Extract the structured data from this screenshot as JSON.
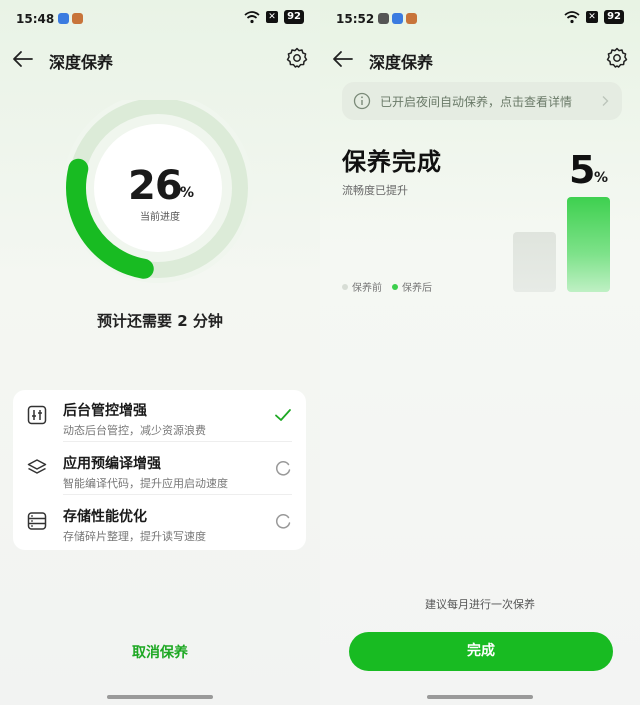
{
  "left": {
    "status": {
      "time": "15:48",
      "battery": "92",
      "x_badge": "✕"
    },
    "header": {
      "title": "深度保养"
    },
    "progress": {
      "value": "26",
      "unit": "%",
      "fraction": 0.26,
      "label": "当前进度"
    },
    "eta": "预计还需要 2 分钟",
    "tasks": [
      {
        "name": "后台管控增强",
        "desc": "动态后台管控，减少资源浪费",
        "state": "done",
        "icon": "sliders-icon"
      },
      {
        "name": "应用预编译增强",
        "desc": "智能编译代码，提升应用启动速度",
        "state": "loading",
        "icon": "layers-icon"
      },
      {
        "name": "存储性能优化",
        "desc": "存储碎片整理，提升读写速度",
        "state": "loading",
        "icon": "storage-icon"
      }
    ],
    "cancel_label": "取消保养"
  },
  "right": {
    "status": {
      "time": "15:52",
      "battery": "92",
      "x_badge": "✕"
    },
    "header": {
      "title": "深度保养"
    },
    "notice": "已开启夜间自动保养，点击查看详情",
    "done_title": "保养完成",
    "done_sub": "流畅度已提升",
    "improvement": {
      "value": "5",
      "unit": "%"
    },
    "legend": {
      "before": "保养前",
      "after": "保养后"
    },
    "advice": "建议每月进行一次保养",
    "finish_label": "完成"
  },
  "colors": {
    "accent": "#18bb22",
    "ring_track": "#e2efe0",
    "check": "#1da823"
  }
}
